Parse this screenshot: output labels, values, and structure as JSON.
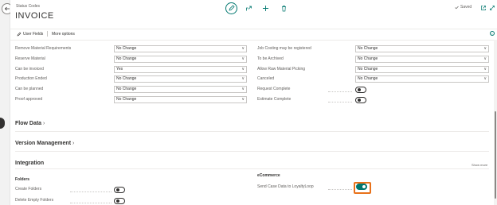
{
  "header": {
    "breadcrumb": "Status Codes",
    "title": "INVOICE",
    "saved_label": "Saved",
    "saved_icon": "checkmark-icon"
  },
  "actions": {
    "user_fields": "User Fields",
    "more_options": "More options"
  },
  "left_fields": [
    {
      "label": "Remove Material Requirements",
      "value": "No Change"
    },
    {
      "label": "Reserve Material",
      "value": "No Change"
    },
    {
      "label": "Can be invoiced",
      "value": "Yes"
    },
    {
      "label": "Production Ended",
      "value": "No Change"
    },
    {
      "label": "Can be planned",
      "value": "No Change"
    },
    {
      "label": "Proof approved",
      "value": "No Change"
    }
  ],
  "right_fields": [
    {
      "label": "Job Costing may be registered",
      "value": "No Change"
    },
    {
      "label": "To be Archived",
      "value": "No Change"
    },
    {
      "label": "Allow Raw Material Picking",
      "value": "No Change"
    },
    {
      "label": "Canceled",
      "value": "No Change"
    },
    {
      "label": "Request Complete",
      "toggle": false
    },
    {
      "label": "Estimate Complete",
      "toggle": false
    }
  ],
  "sections": {
    "flow_data": "Flow Data",
    "version_management": "Version Management",
    "integration": "Integration",
    "show_more": "Show more"
  },
  "integration": {
    "folders_heading": "Folders",
    "create_folders": {
      "label": "Create Folders",
      "toggle": false
    },
    "delete_empty_folders": {
      "label": "Delete Empty Folders",
      "toggle": false
    },
    "ecommerce_heading": "eCommerce",
    "send_case_data": {
      "label": "Send Case Data to LoyaltyLoop",
      "toggle": true
    }
  },
  "colors": {
    "accent": "#00776f",
    "highlight": "#e8711a"
  }
}
